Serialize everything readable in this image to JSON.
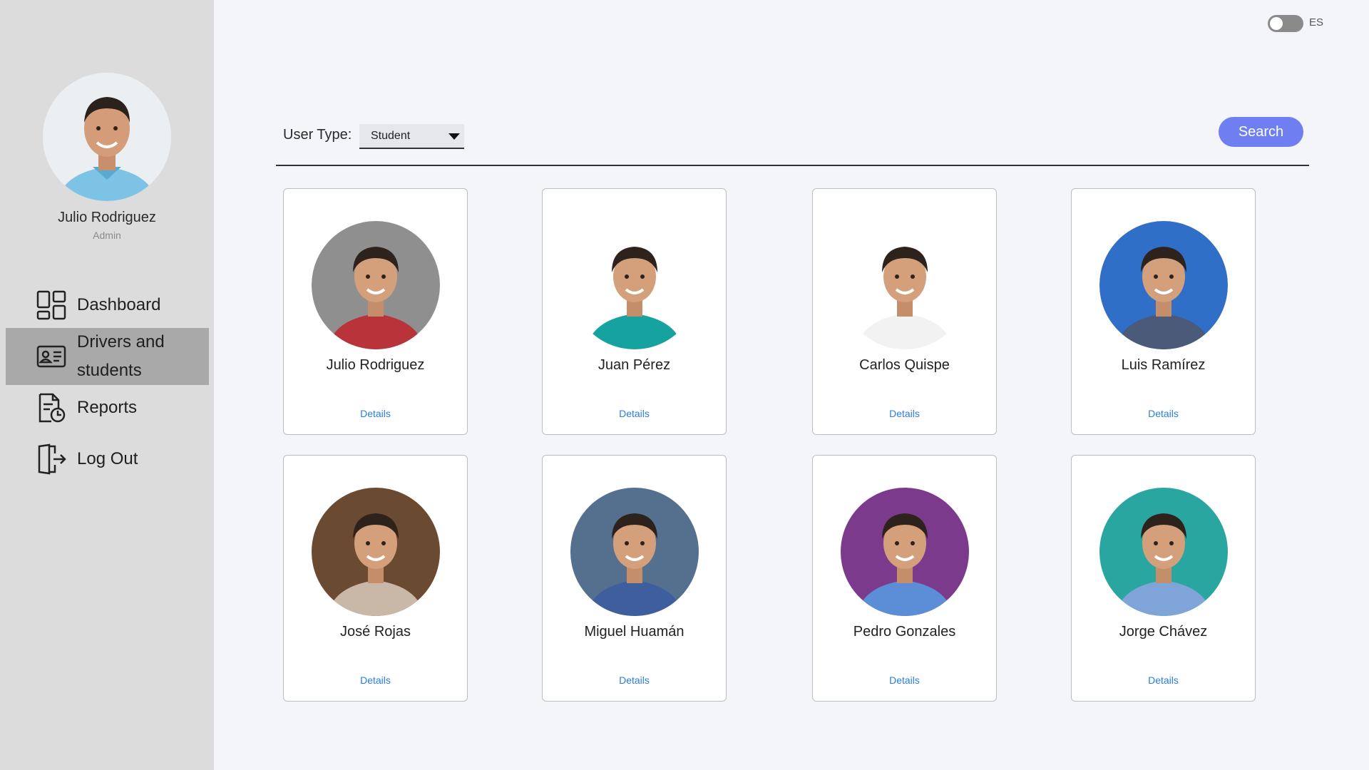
{
  "profile": {
    "name": "Julio Rodriguez",
    "role": "Admin"
  },
  "nav": {
    "dashboard": "Dashboard",
    "drivers": "Drivers and students",
    "reports": "Reports",
    "logout": "Log Out"
  },
  "language": {
    "label": "ES",
    "enabled": false
  },
  "filter": {
    "label": "User Type:",
    "selected": "Student",
    "search_label": "Search"
  },
  "cards": [
    {
      "name": "Julio Rodriguez",
      "details": "Details",
      "bg": "#8f8f8f",
      "shirt": "#b8343a"
    },
    {
      "name": "Juan Pérez",
      "details": "Details",
      "bg": "#ffffff",
      "shirt": "#16a3a0"
    },
    {
      "name": "Carlos Quispe",
      "details": "Details",
      "bg": "#ffffff",
      "shirt": "#f2f2f2"
    },
    {
      "name": "Luis Ramírez",
      "details": "Details",
      "bg": "#2f6fc7",
      "shirt": "#4a5a78"
    },
    {
      "name": "José Rojas",
      "details": "Details",
      "bg": "#6b4a32",
      "shirt": "#c9b7a8"
    },
    {
      "name": "Miguel Huamán",
      "details": "Details",
      "bg": "#55708f",
      "shirt": "#3f5e9e"
    },
    {
      "name": "Pedro Gonzales",
      "details": "Details",
      "bg": "#7b3a8c",
      "shirt": "#5b8ed6"
    },
    {
      "name": "Jorge Chávez",
      "details": "Details",
      "bg": "#2aa6a0",
      "shirt": "#7ea4d8"
    }
  ],
  "colors": {
    "accent": "#6f7ff2",
    "link": "#2a7de1",
    "sidebar": "#dcdcdc",
    "active_nav": "#a9a9a9"
  }
}
